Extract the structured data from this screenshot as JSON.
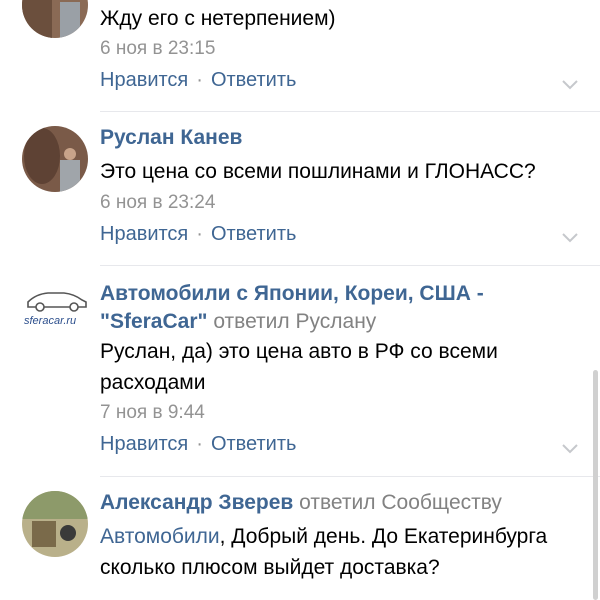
{
  "comments": [
    {
      "text": "Жду его с нетерпением)",
      "time": "6 ноя в 23:15",
      "like": "Нравится",
      "reply": "Ответить"
    },
    {
      "author": "Руслан Канев",
      "text": "Это цена со всеми пошлинами и ГЛОНАСС?",
      "time": "6 ноя в 23:24",
      "like": "Нравится",
      "reply": "Ответить"
    },
    {
      "author_line1": "Автомобили с Японии, Кореи, США -",
      "author_line2": "\"SferaCar\"",
      "reply_to": "ответил Руслану",
      "logo_text": "sferacar.ru",
      "text": "Руслан, да) это цена авто в РФ со всеми расходами",
      "time": "7 ноя в 9:44",
      "like": "Нравится",
      "reply": "Ответить"
    },
    {
      "author": "Александр Зверев",
      "reply_to": "ответил Сообществу",
      "mention": "Автомобили",
      "text": ", Добрый день. До Екатеринбурга сколько плюсом выйдет доставка?"
    }
  ],
  "colors": {
    "link": "#3f6693",
    "meta": "#939393",
    "separator": "#e7e8ec"
  }
}
